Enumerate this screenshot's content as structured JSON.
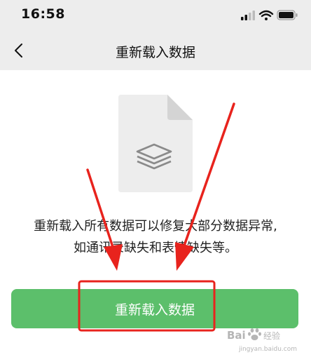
{
  "status_bar": {
    "time": "16:58",
    "icons": [
      "cellular-signal-icon",
      "wifi-icon",
      "battery-icon"
    ]
  },
  "nav": {
    "title": "重新载入数据",
    "back_icon": "chevron-left-icon"
  },
  "illustration": {
    "icon": "document-layers-icon"
  },
  "content": {
    "line1": "重新载入所有数据可以修复大部分数据异常,",
    "line2": "如通讯录缺失和表情缺失等。"
  },
  "actions": {
    "reload_label": "重新载入数据"
  },
  "watermark": {
    "text": "jingyan.baidu.com"
  },
  "colors": {
    "bar_background": "#ededed",
    "button_green": "#5cbf6b",
    "annotation_red": "#e8231d"
  }
}
